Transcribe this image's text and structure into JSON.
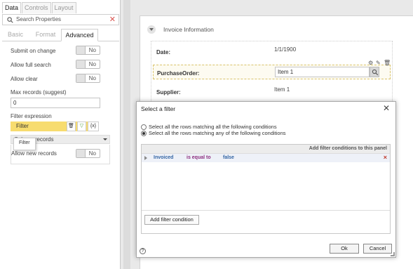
{
  "left_panel": {
    "top_tabs": [
      "Data",
      "Controls",
      "Layout"
    ],
    "search_placeholder": "Search Properties",
    "sub_tabs": [
      "Basic",
      "Format",
      "Advanced"
    ],
    "properties": [
      {
        "label": "Submit on change",
        "value": "No"
      },
      {
        "label": "Allow full search",
        "value": "No"
      },
      {
        "label": "Allow clear",
        "value": "No"
      }
    ],
    "max_records_label": "Max records (suggest)",
    "max_records_value": "0",
    "filter_expression_label": "Filter expression",
    "filter_value": "Filter",
    "filter_btn_fx": "{x}",
    "section_header": "Column records",
    "tooltip": "Filter",
    "allow_new_label": "Allow new records",
    "allow_new_value": "No"
  },
  "canvas": {
    "section_title": "Invoice Information",
    "rows": [
      {
        "label": "Date:",
        "value": "1/1/1900"
      },
      {
        "label": "PurchaseOrder:",
        "value": "Item 1"
      },
      {
        "label": "Supplier:",
        "value": "Item 1"
      }
    ]
  },
  "dialog": {
    "title": "Select a filter",
    "radio_all": "Select all the rows matching all the following conditions",
    "radio_any": "Select all the rows matching any of the following conditions",
    "panel_header": "Add filter conditions to this panel",
    "condition": {
      "field": "Invoiced",
      "operator": "is equal to",
      "value": "false"
    },
    "add_condition_label": "Add filter condition",
    "ok_label": "Ok",
    "cancel_label": "Cancel",
    "help": "?"
  }
}
